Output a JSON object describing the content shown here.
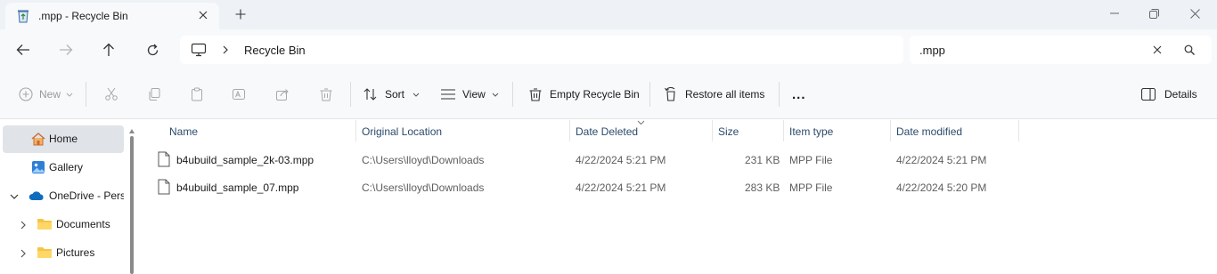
{
  "window": {
    "tab_title": ".mpp - Recycle Bin",
    "tab_icon": "recycle-bin-icon",
    "colors": {
      "titlebar": "#eef2f6",
      "toolbar": "#f7f9fb",
      "selected": "#e0e3e8",
      "header_text": "#2b4a6b"
    }
  },
  "address": {
    "location_icon": "this-pc-icon",
    "path": "Recycle Bin"
  },
  "search": {
    "value": ".mpp"
  },
  "toolbar": {
    "new": "New",
    "sort": "Sort",
    "view": "View",
    "empty": "Empty Recycle Bin",
    "restore_all": "Restore all items",
    "more": "...",
    "details": "Details"
  },
  "sidebar": {
    "items": [
      {
        "label": "Home",
        "icon": "home-icon"
      },
      {
        "label": "Gallery",
        "icon": "gallery-icon"
      },
      {
        "label": "OneDrive - Personal",
        "icon": "onedrive-cloud-icon"
      },
      {
        "label": "Documents",
        "icon": "folder-icon"
      },
      {
        "label": "Pictures",
        "icon": "folder-icon"
      }
    ]
  },
  "table": {
    "columns": [
      "Name",
      "Original Location",
      "Date Deleted",
      "Size",
      "Item type",
      "Date modified"
    ],
    "sorted_column": "Date Deleted",
    "rows": [
      {
        "name": "b4ubuild_sample_2k-03.mpp",
        "location": "C:\\Users\\lloyd\\Downloads",
        "deleted": "4/22/2024 5:21 PM",
        "size": "231 KB",
        "type": "MPP File",
        "modified": "4/22/2024 5:21 PM"
      },
      {
        "name": "b4ubuild_sample_07.mpp",
        "location": "C:\\Users\\lloyd\\Downloads",
        "deleted": "4/22/2024 5:21 PM",
        "size": "283 KB",
        "type": "MPP File",
        "modified": "4/22/2024 5:20 PM"
      }
    ]
  }
}
